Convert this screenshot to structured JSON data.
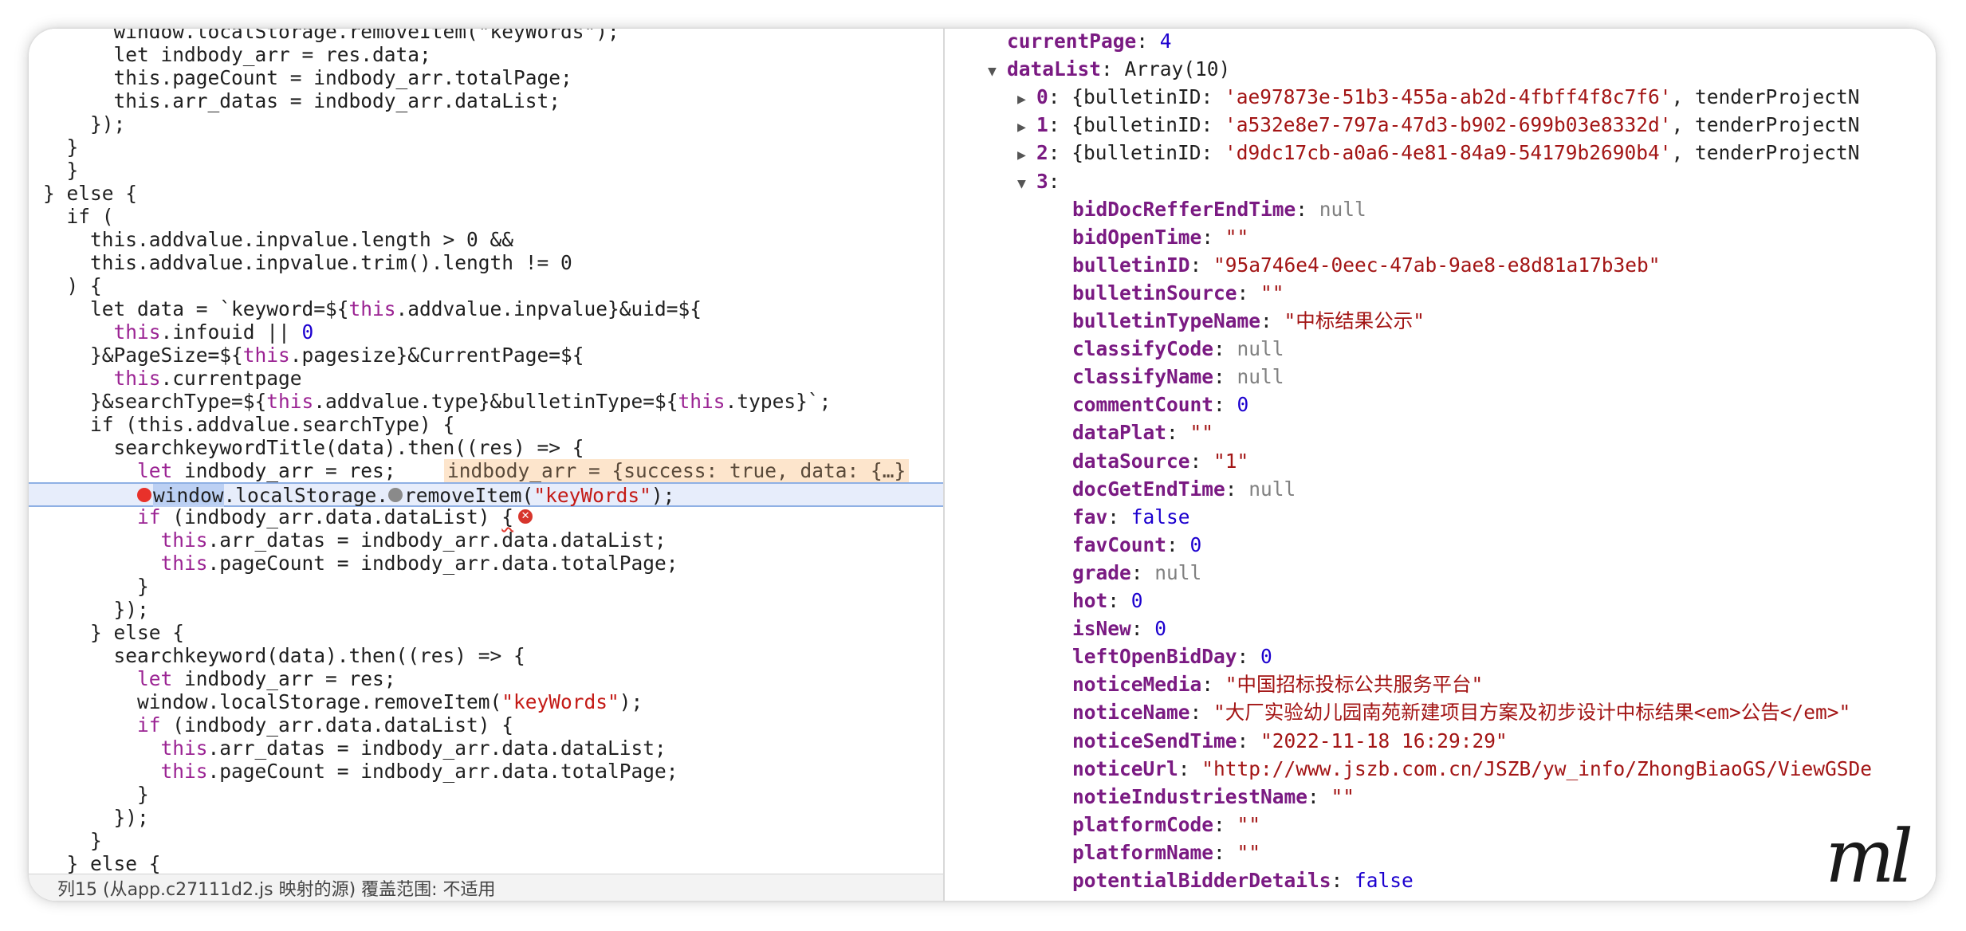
{
  "source": {
    "lines": [
      {
        "segs": [
          {
            "t": "      window.localStorage.removeItem(\"keyWords\");",
            "c": "p"
          }
        ]
      },
      {
        "segs": [
          {
            "t": "      let indbody_arr = res.data;",
            "c": "p"
          }
        ]
      },
      {
        "segs": [
          {
            "t": "      this.pageCount = indbody_arr.totalPage;",
            "c": "p"
          }
        ]
      },
      {
        "segs": [
          {
            "t": "      this.arr_datas = indbody_arr.dataList;",
            "c": "p"
          }
        ]
      },
      {
        "segs": [
          {
            "t": "    });",
            "c": "p"
          }
        ]
      },
      {
        "segs": [
          {
            "t": "  }",
            "c": "p"
          }
        ]
      },
      {
        "segs": [
          {
            "t": "  }",
            "c": "p"
          }
        ]
      },
      {
        "segs": [
          {
            "t": "} else {",
            "c": "p"
          }
        ]
      },
      {
        "segs": [
          {
            "t": "  if (",
            "c": "p"
          }
        ]
      },
      {
        "segs": [
          {
            "t": "    this.addvalue.inpvalue.length > 0 &&",
            "c": "p"
          }
        ]
      },
      {
        "segs": [
          {
            "t": "    this.addvalue.inpvalue.trim().length != 0",
            "c": "p"
          }
        ]
      },
      {
        "segs": [
          {
            "t": "  ) {",
            "c": "p"
          }
        ]
      },
      {
        "segs": [
          {
            "t": "    let data = `keyword=${",
            "c": "p"
          },
          {
            "t": "this",
            "c": "kw"
          },
          {
            "t": ".addvalue.inpvalue}&uid=${",
            "c": "p"
          }
        ]
      },
      {
        "segs": [
          {
            "t": "      this",
            "c": "kw"
          },
          {
            "t": ".infouid || ",
            "c": "p"
          },
          {
            "t": "0",
            "c": "num"
          }
        ]
      },
      {
        "segs": [
          {
            "t": "    }&PageSize=${",
            "c": "p"
          },
          {
            "t": "this",
            "c": "kw"
          },
          {
            "t": ".pagesize}&CurrentPage=${",
            "c": "p"
          }
        ]
      },
      {
        "segs": [
          {
            "t": "      this",
            "c": "kw"
          },
          {
            "t": ".currentpage",
            "c": "p"
          }
        ]
      },
      {
        "segs": [
          {
            "t": "    }&searchType=${",
            "c": "p"
          },
          {
            "t": "this",
            "c": "kw"
          },
          {
            "t": ".addvalue.type}&bulletinType=${",
            "c": "p"
          },
          {
            "t": "this",
            "c": "kw"
          },
          {
            "t": ".types}`;",
            "c": "p"
          }
        ]
      },
      {
        "segs": [
          {
            "t": "    if (this.addvalue.searchType) {",
            "c": "p"
          }
        ]
      },
      {
        "segs": [
          {
            "t": "      searchkeywordTitle(data).then((res) => {",
            "c": "p"
          }
        ]
      },
      {
        "segs": [
          {
            "t": "        ",
            "c": "p"
          },
          {
            "t": "let",
            "c": "kw"
          },
          {
            "t": " indbody_arr = res;",
            "c": "p"
          }
        ]
      },
      {
        "segs": [
          {
            "t": "        ",
            "c": "p"
          },
          {
            "t": "window",
            "c": "sel"
          },
          {
            "t": ".localStorage.",
            "c": "p"
          },
          {
            "t": "removeItem(",
            "c": "p"
          },
          {
            "t": "\"keyWords\"",
            "c": "str"
          },
          {
            "t": ");",
            "c": "p"
          }
        ]
      },
      {
        "segs": [
          {
            "t": "        ",
            "c": "p"
          },
          {
            "t": "if",
            "c": "kw"
          },
          {
            "t": " (indbody_arr.data.dataList) ",
            "c": "p"
          },
          {
            "t": "{",
            "c": "sq"
          }
        ]
      },
      {
        "segs": [
          {
            "t": "          ",
            "c": "p"
          },
          {
            "t": "this",
            "c": "kw"
          },
          {
            "t": ".arr_datas = indbody_arr.data.dataList;",
            "c": "p"
          }
        ]
      },
      {
        "segs": [
          {
            "t": "          ",
            "c": "p"
          },
          {
            "t": "this",
            "c": "kw"
          },
          {
            "t": ".pageCount = indbody_arr.data.totalPage;",
            "c": "p"
          }
        ]
      },
      {
        "segs": [
          {
            "t": "        }",
            "c": "p"
          }
        ]
      },
      {
        "segs": [
          {
            "t": "      });",
            "c": "p"
          }
        ]
      },
      {
        "segs": [
          {
            "t": "    } else {",
            "c": "p"
          }
        ]
      },
      {
        "segs": [
          {
            "t": "      searchkeyword(data).then((res) => {",
            "c": "p"
          }
        ]
      },
      {
        "segs": [
          {
            "t": "        ",
            "c": "p"
          },
          {
            "t": "let",
            "c": "kw"
          },
          {
            "t": " indbody_arr = res;",
            "c": "p"
          }
        ]
      },
      {
        "segs": [
          {
            "t": "        window.localStorage.removeItem(",
            "c": "p"
          },
          {
            "t": "\"keyWords\"",
            "c": "str"
          },
          {
            "t": ");",
            "c": "p"
          }
        ]
      },
      {
        "segs": [
          {
            "t": "        ",
            "c": "p"
          },
          {
            "t": "if",
            "c": "kw"
          },
          {
            "t": " (indbody_arr.data.dataList) {",
            "c": "p"
          }
        ]
      },
      {
        "segs": [
          {
            "t": "          ",
            "c": "p"
          },
          {
            "t": "this",
            "c": "kw"
          },
          {
            "t": ".arr_datas = indbody_arr.data.dataList;",
            "c": "p"
          }
        ]
      },
      {
        "segs": [
          {
            "t": "          ",
            "c": "p"
          },
          {
            "t": "this",
            "c": "kw"
          },
          {
            "t": ".pageCount = indbody_arr.data.totalPage;",
            "c": "p"
          }
        ]
      },
      {
        "segs": [
          {
            "t": "        }",
            "c": "p"
          }
        ]
      },
      {
        "segs": [
          {
            "t": "      });",
            "c": "p"
          }
        ]
      },
      {
        "segs": [
          {
            "t": "    }",
            "c": "p"
          }
        ]
      },
      {
        "segs": [
          {
            "t": "  } else {",
            "c": "p"
          }
        ]
      }
    ],
    "inline_value": "indbody_arr = {success: true, data: {…}",
    "status_text": "列15 (从app.c27111d2.js 映射的源) 覆盖范围: 不适用"
  },
  "scope": {
    "lines": [
      {
        "i": 0,
        "segs": [
          {
            "t": "currentPage",
            "c": "key"
          },
          {
            "t": ": ",
            "c": "p"
          },
          {
            "t": "4",
            "c": "num"
          }
        ]
      },
      {
        "i": 0,
        "tri": "▼",
        "segs": [
          {
            "t": "dataList",
            "c": "key"
          },
          {
            "t": ": Array(10)",
            "c": "p"
          }
        ]
      },
      {
        "i": 1,
        "tri": "▶",
        "segs": [
          {
            "t": "0",
            "c": "key"
          },
          {
            "t": ": {bulletinID: ",
            "c": "p"
          },
          {
            "t": "'ae97873e-51b3-455a-ab2d-4fbff4f8c7f6'",
            "c": "str"
          },
          {
            "t": ", tenderProjectN",
            "c": "p"
          }
        ]
      },
      {
        "i": 1,
        "tri": "▶",
        "segs": [
          {
            "t": "1",
            "c": "key"
          },
          {
            "t": ": {bulletinID: ",
            "c": "p"
          },
          {
            "t": "'a532e8e7-797a-47d3-b902-699b03e8332d'",
            "c": "str"
          },
          {
            "t": ", tenderProjectN",
            "c": "p"
          }
        ]
      },
      {
        "i": 1,
        "tri": "▶",
        "segs": [
          {
            "t": "2",
            "c": "key"
          },
          {
            "t": ": {bulletinID: ",
            "c": "p"
          },
          {
            "t": "'d9dc17cb-a0a6-4e81-84a9-54179b2690b4'",
            "c": "str"
          },
          {
            "t": ", tenderProjectN",
            "c": "p"
          }
        ]
      },
      {
        "i": 1,
        "tri": "▼",
        "segs": [
          {
            "t": "3",
            "c": "key"
          },
          {
            "t": ":",
            "c": "p"
          }
        ]
      },
      {
        "i": 2,
        "segs": [
          {
            "t": "bidDocRefferEndTime",
            "c": "key"
          },
          {
            "t": ": ",
            "c": "p"
          },
          {
            "t": "null",
            "c": "null"
          }
        ]
      },
      {
        "i": 2,
        "segs": [
          {
            "t": "bidOpenTime",
            "c": "key"
          },
          {
            "t": ": ",
            "c": "p"
          },
          {
            "t": "\"\"",
            "c": "str"
          }
        ]
      },
      {
        "i": 2,
        "segs": [
          {
            "t": "bulletinID",
            "c": "key"
          },
          {
            "t": ": ",
            "c": "p"
          },
          {
            "t": "\"95a746e4-0eec-47ab-9ae8-e8d81a17b3eb\"",
            "c": "str"
          }
        ]
      },
      {
        "i": 2,
        "segs": [
          {
            "t": "bulletinSource",
            "c": "key"
          },
          {
            "t": ": ",
            "c": "p"
          },
          {
            "t": "\"\"",
            "c": "str"
          }
        ]
      },
      {
        "i": 2,
        "segs": [
          {
            "t": "bulletinTypeName",
            "c": "key"
          },
          {
            "t": ": ",
            "c": "p"
          },
          {
            "t": "\"中标结果公示\"",
            "c": "str"
          }
        ]
      },
      {
        "i": 2,
        "segs": [
          {
            "t": "classifyCode",
            "c": "key"
          },
          {
            "t": ": ",
            "c": "p"
          },
          {
            "t": "null",
            "c": "null"
          }
        ]
      },
      {
        "i": 2,
        "segs": [
          {
            "t": "classifyName",
            "c": "key"
          },
          {
            "t": ": ",
            "c": "p"
          },
          {
            "t": "null",
            "c": "null"
          }
        ]
      },
      {
        "i": 2,
        "segs": [
          {
            "t": "commentCount",
            "c": "key"
          },
          {
            "t": ": ",
            "c": "p"
          },
          {
            "t": "0",
            "c": "num"
          }
        ]
      },
      {
        "i": 2,
        "segs": [
          {
            "t": "dataPlat",
            "c": "key"
          },
          {
            "t": ": ",
            "c": "p"
          },
          {
            "t": "\"\"",
            "c": "str"
          }
        ]
      },
      {
        "i": 2,
        "segs": [
          {
            "t": "dataSource",
            "c": "key"
          },
          {
            "t": ": ",
            "c": "p"
          },
          {
            "t": "\"1\"",
            "c": "str"
          }
        ]
      },
      {
        "i": 2,
        "segs": [
          {
            "t": "docGetEndTime",
            "c": "key"
          },
          {
            "t": ": ",
            "c": "p"
          },
          {
            "t": "null",
            "c": "null"
          }
        ]
      },
      {
        "i": 2,
        "segs": [
          {
            "t": "fav",
            "c": "key"
          },
          {
            "t": ": ",
            "c": "p"
          },
          {
            "t": "false",
            "c": "num"
          }
        ]
      },
      {
        "i": 2,
        "segs": [
          {
            "t": "favCount",
            "c": "key"
          },
          {
            "t": ": ",
            "c": "p"
          },
          {
            "t": "0",
            "c": "num"
          }
        ]
      },
      {
        "i": 2,
        "segs": [
          {
            "t": "grade",
            "c": "key"
          },
          {
            "t": ": ",
            "c": "p"
          },
          {
            "t": "null",
            "c": "null"
          }
        ]
      },
      {
        "i": 2,
        "segs": [
          {
            "t": "hot",
            "c": "key"
          },
          {
            "t": ": ",
            "c": "p"
          },
          {
            "t": "0",
            "c": "num"
          }
        ]
      },
      {
        "i": 2,
        "segs": [
          {
            "t": "isNew",
            "c": "key"
          },
          {
            "t": ": ",
            "c": "p"
          },
          {
            "t": "0",
            "c": "num"
          }
        ]
      },
      {
        "i": 2,
        "segs": [
          {
            "t": "leftOpenBidDay",
            "c": "key"
          },
          {
            "t": ": ",
            "c": "p"
          },
          {
            "t": "0",
            "c": "num"
          }
        ]
      },
      {
        "i": 2,
        "segs": [
          {
            "t": "noticeMedia",
            "c": "key"
          },
          {
            "t": ": ",
            "c": "p"
          },
          {
            "t": "\"中国招标投标公共服务平台\"",
            "c": "str"
          }
        ]
      },
      {
        "i": 2,
        "segs": [
          {
            "t": "noticeName",
            "c": "key"
          },
          {
            "t": ": ",
            "c": "p"
          },
          {
            "t": "\"大厂实验幼儿园南苑新建项目方案及初步设计中标结果<em>公告</em>\"",
            "c": "str"
          }
        ]
      },
      {
        "i": 2,
        "segs": [
          {
            "t": "noticeSendTime",
            "c": "key"
          },
          {
            "t": ": ",
            "c": "p"
          },
          {
            "t": "\"2022-11-18 16:29:29\"",
            "c": "str"
          }
        ]
      },
      {
        "i": 2,
        "segs": [
          {
            "t": "noticeUrl",
            "c": "key"
          },
          {
            "t": ": ",
            "c": "p"
          },
          {
            "t": "\"http://www.jszb.com.cn/JSZB/yw_info/ZhongBiaoGS/ViewGSDe",
            "c": "str"
          }
        ]
      },
      {
        "i": 2,
        "segs": [
          {
            "t": "notieIndustriestName",
            "c": "key"
          },
          {
            "t": ": ",
            "c": "p"
          },
          {
            "t": "\"\"",
            "c": "str"
          }
        ]
      },
      {
        "i": 2,
        "segs": [
          {
            "t": "platformCode",
            "c": "key"
          },
          {
            "t": ": ",
            "c": "p"
          },
          {
            "t": "\"\"",
            "c": "str"
          }
        ]
      },
      {
        "i": 2,
        "segs": [
          {
            "t": "platformName",
            "c": "key"
          },
          {
            "t": ": ",
            "c": "p"
          },
          {
            "t": "\"\"",
            "c": "str"
          }
        ]
      },
      {
        "i": 2,
        "segs": [
          {
            "t": "potentialBidderDetails",
            "c": "key"
          },
          {
            "t": ": ",
            "c": "p"
          },
          {
            "t": "false",
            "c": "num"
          }
        ]
      }
    ]
  },
  "signature": "ml",
  "colors": {
    "keyword": "#9b2393",
    "number": "#1c00cf",
    "string": "#c41a16",
    "property_key": "#7a1a82",
    "null": "#808080",
    "breakpoint": "#e8312a",
    "highlight_line": "#e7edfb",
    "inline_value_bg": "#fde5cc"
  }
}
